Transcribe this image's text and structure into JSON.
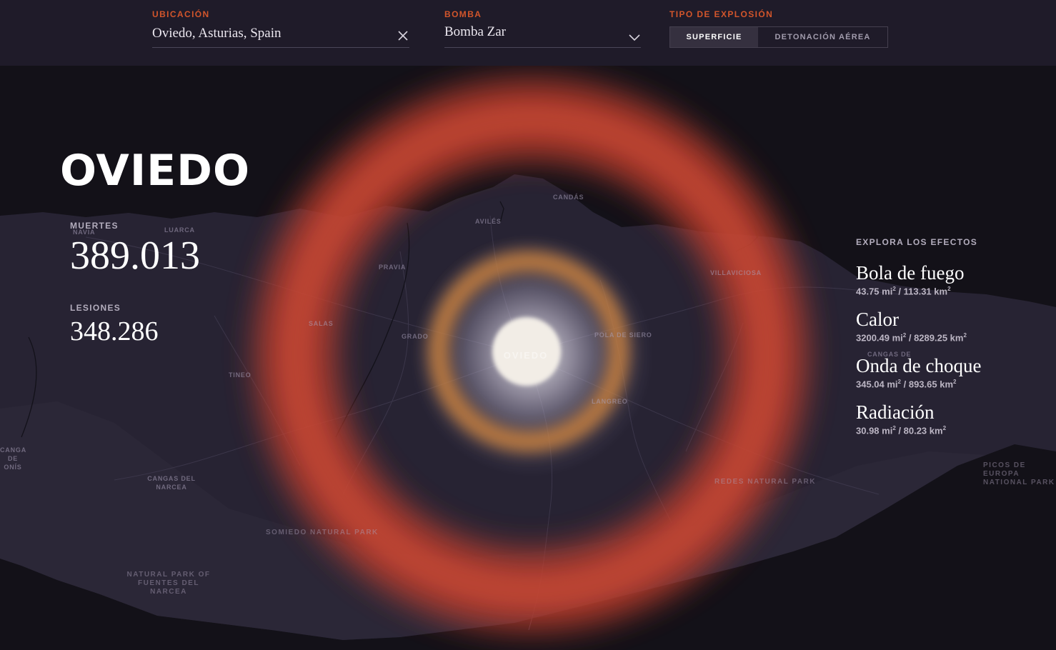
{
  "controls": {
    "location": {
      "label": "UBICACIÓN",
      "value": "Oviedo, Asturias, Spain",
      "clear_icon": "close-icon"
    },
    "bomb": {
      "label": "BOMBA",
      "value": "Bomba Zar",
      "dropdown_icon": "chevron-down-icon"
    },
    "explosion_type": {
      "label": "TIPO DE EXPLOSIÓN",
      "options": [
        "SUPERFICIE",
        "DETONACIÓN AÉREA"
      ],
      "selected": "SUPERFICIE"
    }
  },
  "city": "OVIEDO",
  "stats": {
    "deaths_label": "MUERTES",
    "deaths_value": "389.013",
    "injuries_label": "LESIONES",
    "injuries_value": "348.286"
  },
  "effects": {
    "heading": "EXPLORA LOS EFECTOS",
    "items": [
      {
        "name": "Bola de fuego",
        "mi": "43.75 mi",
        "km": " / 113.31 km"
      },
      {
        "name": "Calor",
        "mi": "3200.49 mi",
        "km": " / 8289.25 km"
      },
      {
        "name": "Onda de choque",
        "mi": "345.04 mi",
        "km": " / 893.65 km"
      },
      {
        "name": "Radiación",
        "mi": "30.98 mi",
        "km": " / 80.23 km"
      }
    ],
    "superscript": "2"
  },
  "map": {
    "center_label": "OVIEDO",
    "places": [
      "NAVIA",
      "LUARCA",
      "AVILÉS",
      "CANDÁS",
      "PRAVIA",
      "VILLAVICIOSA",
      "SALAS",
      "GRADO",
      "POLA DE SIERO",
      "TINEO",
      "LANGREO",
      "CANGAS DE",
      "CANGAS DEL NARCEA",
      "CANGAS DE ONÍS",
      "REDES NATURAL PARK",
      "SOMIEDO NATURAL PARK",
      "NATURAL PARK OF FUENTES DEL NARCEA",
      "PICOS DE EUROPA NATIONAL PARK"
    ],
    "colors": {
      "sea": "#121017",
      "land": "#2a2636",
      "heat_ring": "#c4402d",
      "fireball": "#f2ede6",
      "shockwave": "#c9813f"
    }
  }
}
